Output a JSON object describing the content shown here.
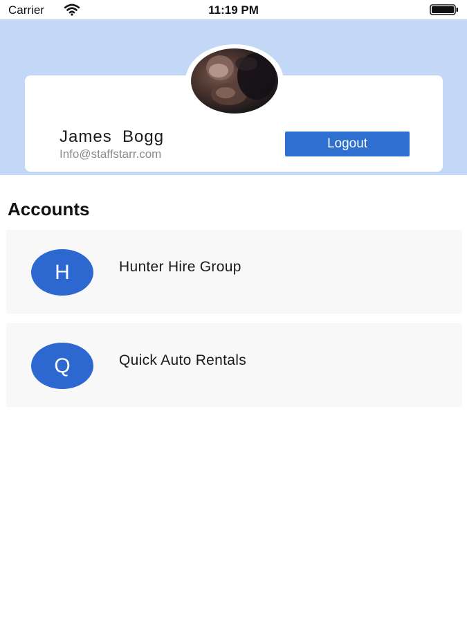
{
  "status_bar": {
    "carrier": "Carrier",
    "time": "11:19 PM",
    "icons": [
      "wifi-icon",
      "battery-icon"
    ]
  },
  "profile": {
    "name": "James  Bogg",
    "email": "Info@staffstarr.com",
    "logout_label": "Logout"
  },
  "accounts": {
    "title": "Accounts",
    "items": [
      {
        "initial": "H",
        "name": "Hunter Hire Group"
      },
      {
        "initial": "Q",
        "name": "Quick Auto Rentals"
      }
    ]
  },
  "colors": {
    "header_band": "#c3d7f6",
    "accent": "#2f6fd0",
    "row_background": "#f8f8f8"
  }
}
